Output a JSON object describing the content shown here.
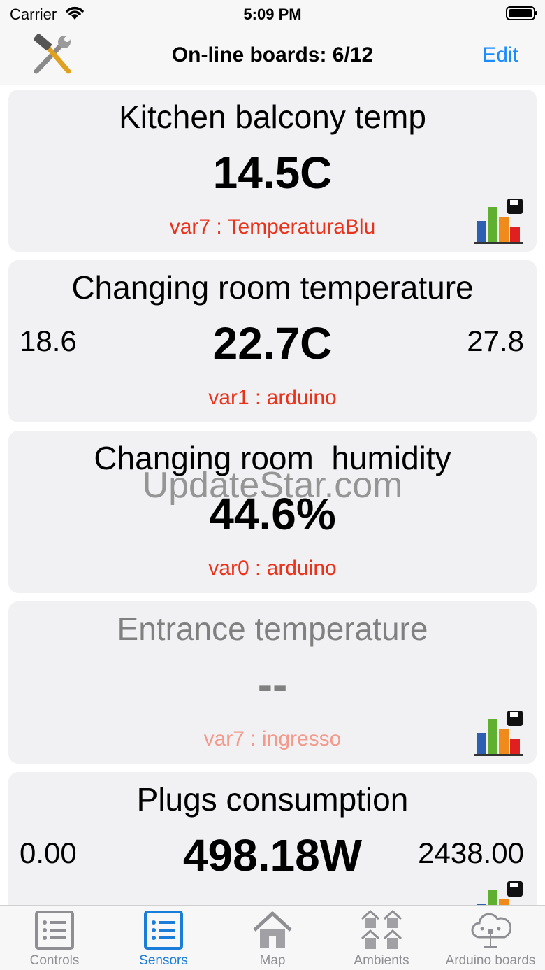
{
  "status_bar": {
    "carrier": "Carrier",
    "time": "5:09 PM"
  },
  "nav": {
    "title": "On-line boards: 6/12",
    "edit": "Edit"
  },
  "cards": [
    {
      "title": "Kitchen balcony temp",
      "value": "14.5C",
      "min": "",
      "max": "",
      "var": "var7 : TemperaturaBlu",
      "chart": true,
      "online": true
    },
    {
      "title": "Changing room temperature",
      "value": "22.7C",
      "min": "18.6",
      "max": "27.8",
      "var": "var1 : arduino",
      "chart": false,
      "online": true
    },
    {
      "title": "Changing room  humidity",
      "value": "44.6%",
      "min": "",
      "max": "",
      "var": "var0 : arduino",
      "chart": false,
      "online": true
    },
    {
      "title": "Entrance temperature",
      "value": "--",
      "min": "",
      "max": "",
      "var": "var7 : ingresso",
      "chart": true,
      "online": false
    },
    {
      "title": "Plugs consumption",
      "value": "498.18W",
      "min": "0.00",
      "max": "2438.00",
      "var": "",
      "chart": true,
      "online": true
    }
  ],
  "watermark": "UpdateStar.com",
  "tabs": [
    {
      "label": "Controls",
      "icon": "list-icon",
      "active": false
    },
    {
      "label": "Sensors",
      "icon": "list-icon",
      "active": true
    },
    {
      "label": "Map",
      "icon": "house-icon",
      "active": false
    },
    {
      "label": "Ambients",
      "icon": "houses-icon",
      "active": false
    },
    {
      "label": "Arduino boards",
      "icon": "cloud-network-icon",
      "active": false
    }
  ],
  "colors": {
    "accent": "#1a8cff",
    "var_text": "#e8321c",
    "card_bg": "#f1f1f3"
  }
}
